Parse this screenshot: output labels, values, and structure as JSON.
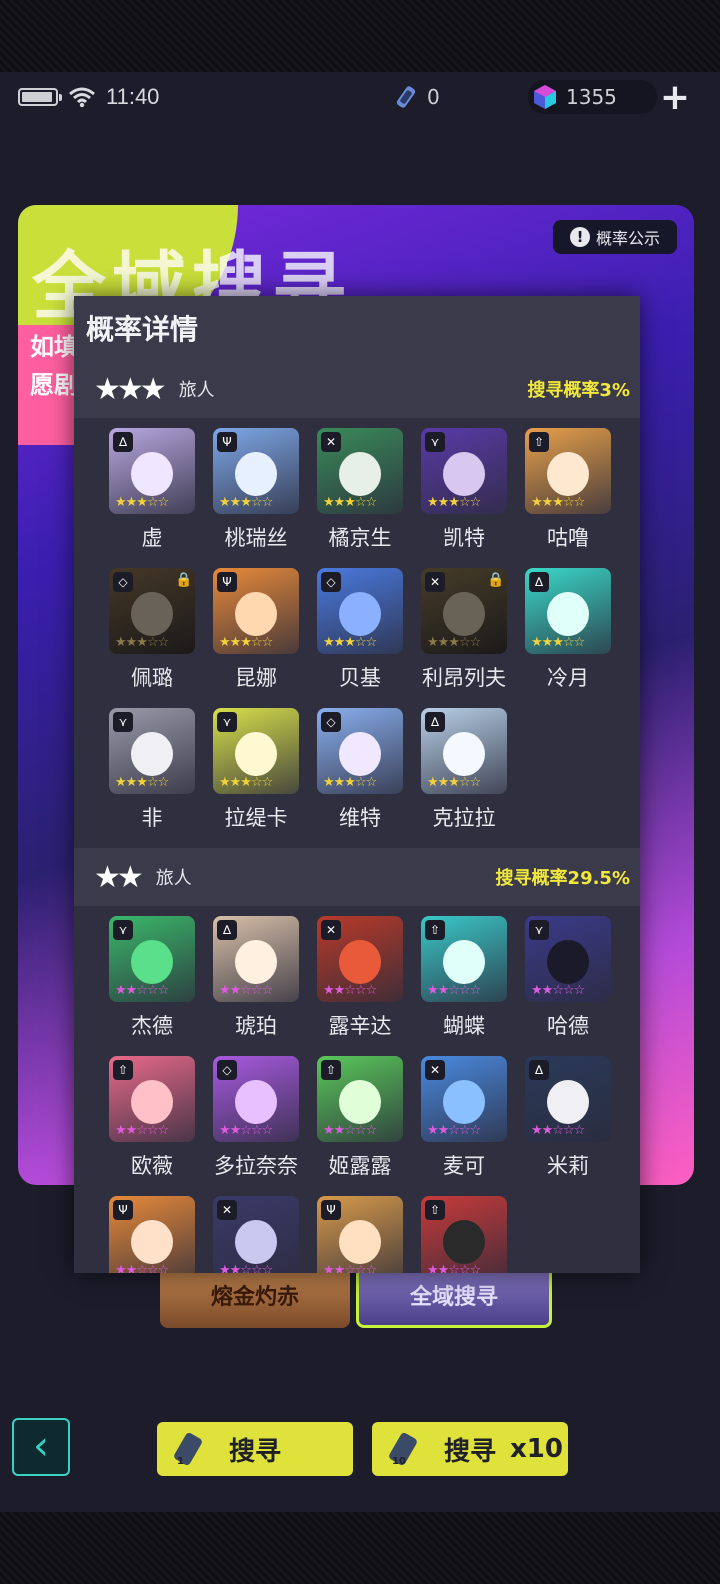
{
  "status": {
    "time": "11:40",
    "tickets": "0",
    "gems": "1355"
  },
  "banner": {
    "title": "全域搜寻",
    "sub1": "如填",
    "sub2": "愿剧",
    "prob_btn": "概率公示",
    "prob_icon": "!"
  },
  "tabs": {
    "fire": "熔金灼赤",
    "all": "全域搜寻"
  },
  "actions": {
    "search": "搜寻",
    "search10": "搜寻",
    "x10": "x10",
    "back": "‹",
    "ticket1": "1",
    "ticket10": "10",
    "plus": "+"
  },
  "modal": {
    "title": "概率详情",
    "tiers": [
      {
        "stars": "★★★",
        "label": "旅人",
        "rate": "搜寻概率3%",
        "chars": [
          {
            "name": "虚",
            "color": "#b8a8e0",
            "face": "#efe6ff",
            "star_color": "#f2d23a",
            "stars": "★★★☆☆",
            "badge": "∆",
            "locked": false
          },
          {
            "name": "桃瑞丝",
            "color": "#7ea8e8",
            "face": "#e6f0ff",
            "star_color": "#f2d23a",
            "stars": "★★★☆☆",
            "badge": "Ψ",
            "locked": false
          },
          {
            "name": "橘京生",
            "color": "#3a8a5a",
            "face": "#e6f0e6",
            "star_color": "#f2d23a",
            "stars": "★★★☆☆",
            "badge": "✕",
            "locked": false
          },
          {
            "name": "凯特",
            "color": "#5a3aa8",
            "face": "#d8c8f0",
            "star_color": "#f2d23a",
            "stars": "★★★☆☆",
            "badge": "⋎",
            "locked": false
          },
          {
            "name": "咕噜",
            "color": "#e8a04a",
            "face": "#ffe8d0",
            "star_color": "#f2d23a",
            "stars": "★★★☆☆",
            "badge": "⇧",
            "locked": false
          },
          {
            "name": "佩璐",
            "color": "#a87a3a",
            "face": "#f0d8b8",
            "star_color": "#8a7a4a",
            "stars": "★★★☆☆",
            "badge": "◇",
            "locked": true
          },
          {
            "name": "昆娜",
            "color": "#e88a3a",
            "face": "#ffd8b0",
            "star_color": "#f2d23a",
            "stars": "★★★☆☆",
            "badge": "Ψ",
            "locked": false
          },
          {
            "name": "贝基",
            "color": "#4a7ae0",
            "face": "#8ab0ff",
            "star_color": "#f2d23a",
            "stars": "★★★☆☆",
            "badge": "◇",
            "locked": false
          },
          {
            "name": "利昂列夫",
            "color": "#a8843a",
            "face": "#f0d8b0",
            "star_color": "#8a7a4a",
            "stars": "★★★☆☆",
            "badge": "✕",
            "locked": true
          },
          {
            "name": "冷月",
            "color": "#3ad8c8",
            "face": "#e0fff8",
            "star_color": "#f2d23a",
            "stars": "★★★☆☆",
            "badge": "∆",
            "locked": false
          },
          {
            "name": "非",
            "color": "#9a9aa8",
            "face": "#f0f0f4",
            "star_color": "#f2d23a",
            "stars": "★★★☆☆",
            "badge": "⋎",
            "locked": false
          },
          {
            "name": "拉缇卡",
            "color": "#d8e04a",
            "face": "#fff8d0",
            "star_color": "#f2d23a",
            "stars": "★★★☆☆",
            "badge": "⋎",
            "locked": false
          },
          {
            "name": "维特",
            "color": "#8ab0f0",
            "face": "#f0e8ff",
            "star_color": "#f2d23a",
            "stars": "★★★☆☆",
            "badge": "◇",
            "locked": false
          },
          {
            "name": "克拉拉",
            "color": "#b8d0e8",
            "face": "#f4f8ff",
            "star_color": "#f2d23a",
            "stars": "★★★☆☆",
            "badge": "∆",
            "locked": false
          }
        ]
      },
      {
        "stars": "★★",
        "label": "旅人",
        "rate": "搜寻概率29.5%",
        "chars": [
          {
            "name": "杰德",
            "color": "#3ab86a",
            "face": "#5ae08a",
            "star_color": "#e05ae0",
            "stars": "★★☆☆☆",
            "badge": "⋎",
            "locked": false
          },
          {
            "name": "琥珀",
            "color": "#d8c0a8",
            "face": "#fff0e0",
            "star_color": "#e05ae0",
            "stars": "★★☆☆☆",
            "badge": "∆",
            "locked": false
          },
          {
            "name": "露辛达",
            "color": "#b83a2a",
            "face": "#e85a3a",
            "star_color": "#e05ae0",
            "stars": "★★☆☆☆",
            "badge": "✕",
            "locked": false
          },
          {
            "name": "蝴蝶",
            "color": "#3ac8c8",
            "face": "#e0fff8",
            "star_color": "#e05ae0",
            "stars": "★★☆☆☆",
            "badge": "⇧",
            "locked": false
          },
          {
            "name": "哈德",
            "color": "#3a3a8a",
            "face": "#1a1a2a",
            "star_color": "#e05ae0",
            "stars": "★★☆☆☆",
            "badge": "⋎",
            "locked": false
          },
          {
            "name": "欧薇",
            "color": "#e86a8a",
            "face": "#ffc0c8",
            "star_color": "#e05ae0",
            "stars": "★★☆☆☆",
            "badge": "⇧",
            "locked": false
          },
          {
            "name": "多拉奈奈",
            "color": "#a85ae0",
            "face": "#e8c0ff",
            "star_color": "#e05ae0",
            "stars": "★★☆☆☆",
            "badge": "◇",
            "locked": false
          },
          {
            "name": "姬露露",
            "color": "#5ac85a",
            "face": "#e0ffd8",
            "star_color": "#e05ae0",
            "stars": "★★☆☆☆",
            "badge": "⇧",
            "locked": false
          },
          {
            "name": "麦可",
            "color": "#4a8ae0",
            "face": "#8ac0ff",
            "star_color": "#e05ae0",
            "stars": "★★☆☆☆",
            "badge": "✕",
            "locked": false
          },
          {
            "name": "米莉",
            "color": "#2a3a5a",
            "face": "#f0f0f4",
            "star_color": "#e05ae0",
            "stars": "★★☆☆☆",
            "badge": "∆",
            "locked": false
          },
          {
            "name": "",
            "color": "#e88a3a",
            "face": "#ffe0c8",
            "star_color": "#e05ae0",
            "stars": "★★☆☆☆",
            "badge": "Ψ",
            "locked": false
          },
          {
            "name": "",
            "color": "#3a3a6a",
            "face": "#c8c8f0",
            "star_color": "#e05ae0",
            "stars": "★★☆☆☆",
            "badge": "✕",
            "locked": false
          },
          {
            "name": "",
            "color": "#d89a4a",
            "face": "#ffe0c0",
            "star_color": "#e05ae0",
            "stars": "★★☆☆☆",
            "badge": "Ψ",
            "locked": false
          },
          {
            "name": "",
            "color": "#c83a3a",
            "face": "#2a2a2a",
            "star_color": "#e05ae0",
            "stars": "★★☆☆☆",
            "badge": "⇧",
            "locked": false
          }
        ]
      }
    ]
  },
  "icons": {
    "wifi": "wifi-icon",
    "battery": "battery-icon",
    "ticket": "ticket-icon",
    "gem": "gem-icon",
    "lock": "lock-icon"
  }
}
